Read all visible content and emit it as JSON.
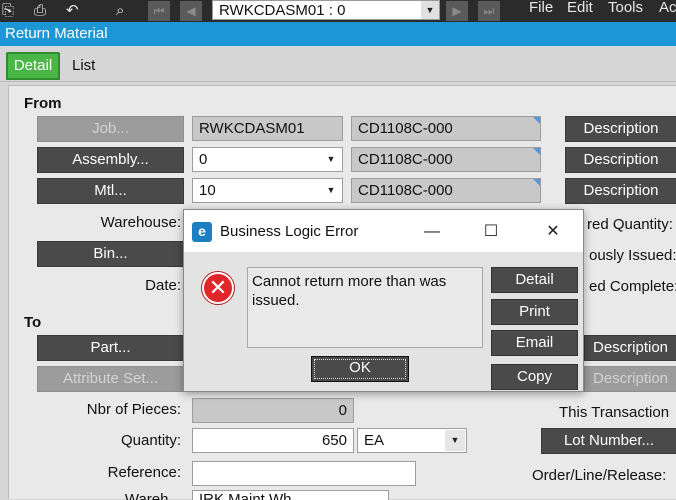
{
  "toolbar": {
    "record_value": "RWKCDASM01 : 0",
    "menu": [
      "File",
      "Edit",
      "Tools",
      "Ac"
    ]
  },
  "window": {
    "title": "Return Material"
  },
  "tabs": [
    {
      "label": "Detail",
      "active": true
    },
    {
      "label": "List",
      "active": false
    }
  ],
  "from": {
    "group_label": "From",
    "job_button": "Job...",
    "job_value": "RWKCDASM01",
    "job_part": "CD1108C-000",
    "assembly_button": "Assembly...",
    "assembly_value": "0",
    "assembly_part": "CD1108C-000",
    "mtl_button": "Mtl...",
    "mtl_value": "10",
    "mtl_part": "CD1108C-000",
    "warehouse_label": "Warehouse:",
    "bin_button": "Bin...",
    "date_label": "Date:",
    "description_buttons": [
      "Description",
      "Description",
      "Description"
    ],
    "right_labels": [
      "red Quantity:",
      "ously Issued:",
      "ed Complete:"
    ]
  },
  "to": {
    "group_label": "To",
    "part_button": "Part...",
    "attribute_button": "Attribute Set...",
    "nbr_pieces_label": "Nbr of Pieces:",
    "nbr_pieces_value": "0",
    "quantity_label": "Quantity:",
    "quantity_value": "650",
    "uom_value": "EA",
    "reference_label": "Reference:",
    "reference_value": "",
    "warehouse_label_partial": "Wareh...",
    "warehouse_value_partial": "IRK Maint Wh...",
    "description_buttons": [
      "Description",
      "Description"
    ],
    "this_transaction_label": "This Transaction",
    "lot_button": "Lot Number...",
    "order_label": "Order/Line/Release:"
  },
  "dialog": {
    "title": "Business Logic Error",
    "message": "Cannot return more than was issued.",
    "buttons": {
      "detail": "Detail",
      "print": "Print",
      "email": "Email",
      "copy": "Copy",
      "ok": "OK"
    }
  },
  "colors": {
    "title_bar": "#1c96d4",
    "active_tab": "#4ab647",
    "button": "#4a4a4a",
    "error": "#e0252b"
  }
}
